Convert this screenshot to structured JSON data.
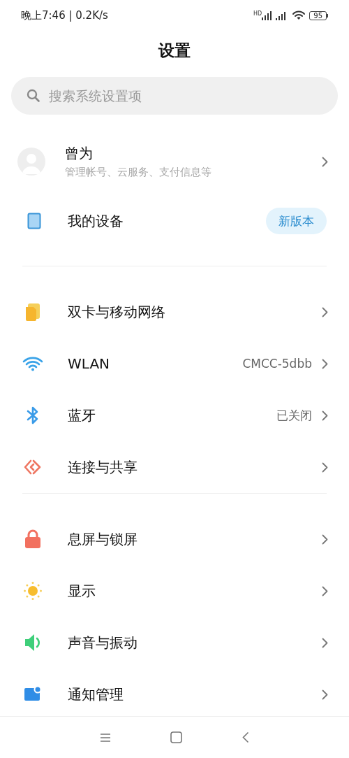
{
  "status_bar": {
    "time": "晚上7:46 | 0.2K/s",
    "network_badge": "HD",
    "battery": "95"
  },
  "title": "设置",
  "search": {
    "placeholder": "搜索系统设置项"
  },
  "account": {
    "name": "曾为",
    "subtitle": "管理帐号、云服务、支付信息等"
  },
  "device": {
    "label": "我的设备",
    "badge": "新版本"
  },
  "groups": [
    {
      "items": [
        {
          "kind": "sim",
          "label": "双卡与移动网络"
        },
        {
          "kind": "wifi",
          "label": "WLAN",
          "value": "CMCC-5dbb"
        },
        {
          "kind": "bluetooth",
          "label": "蓝牙",
          "value": "已关闭"
        },
        {
          "kind": "share",
          "label": "连接与共享"
        }
      ]
    },
    {
      "items": [
        {
          "kind": "lock",
          "label": "息屏与锁屏"
        },
        {
          "kind": "sun",
          "label": "显示"
        },
        {
          "kind": "sound",
          "label": "声音与振动"
        },
        {
          "kind": "notify",
          "label": "通知管理"
        }
      ]
    }
  ]
}
